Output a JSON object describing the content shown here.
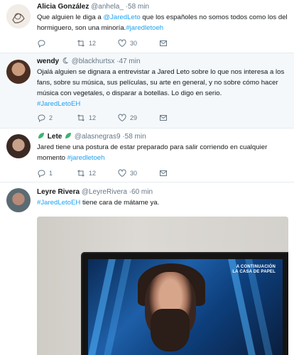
{
  "tweets": [
    {
      "name": "Alicia González",
      "handle": "@anhela_",
      "time": "·58 min",
      "text_1": "Que alguien le diga a ",
      "mention": "@JaredLeto",
      "text_2": " que los españoles no somos todos como los del hormiguero, son una minoría.",
      "hashtag": "#jaredletoeh",
      "retweets": "12",
      "likes": "30"
    },
    {
      "name": "wendy",
      "handle": "@blackhurtsx",
      "time": "·47 min",
      "text": "Ojalá alguien se dignara a entrevistar a Jared Leto sobre lo que nos interesa a los fans, sobre su música, sus películas, su arte en general, y no sobre cómo hacer música con vegetales, o disparar a botellas. Lo digo en serio.",
      "hashtag": "#JaredLetoEH",
      "replies": "2",
      "retweets": "12",
      "likes": "29"
    },
    {
      "name": "Lete",
      "handle": "@alasnegras9",
      "time": "·58 min",
      "text": "Jared tiene una postura de estar preparado para salir corriendo en cualquier momento ",
      "hashtag": "#jaredletoeh",
      "replies": "1",
      "retweets": "12",
      "likes": "30"
    },
    {
      "name": "Leyre Rivera",
      "handle": "@LeyreRivera",
      "time": "·60 min",
      "hashtag": "#JaredLetoEH",
      "text": " tiene cara de mátame ya.",
      "media_overlay_1": "A CONTINUACIÓN",
      "media_overlay_2": "LA CASA DE PAPEL"
    }
  ],
  "colors": {
    "link": "#1da1f2",
    "muted": "#657786",
    "highlight_bg": "#f5f8fa",
    "verified_leaf": "#3cb371"
  },
  "icons": [
    "reply-icon",
    "retweet-icon",
    "like-icon",
    "message-icon",
    "leaf-icon"
  ]
}
